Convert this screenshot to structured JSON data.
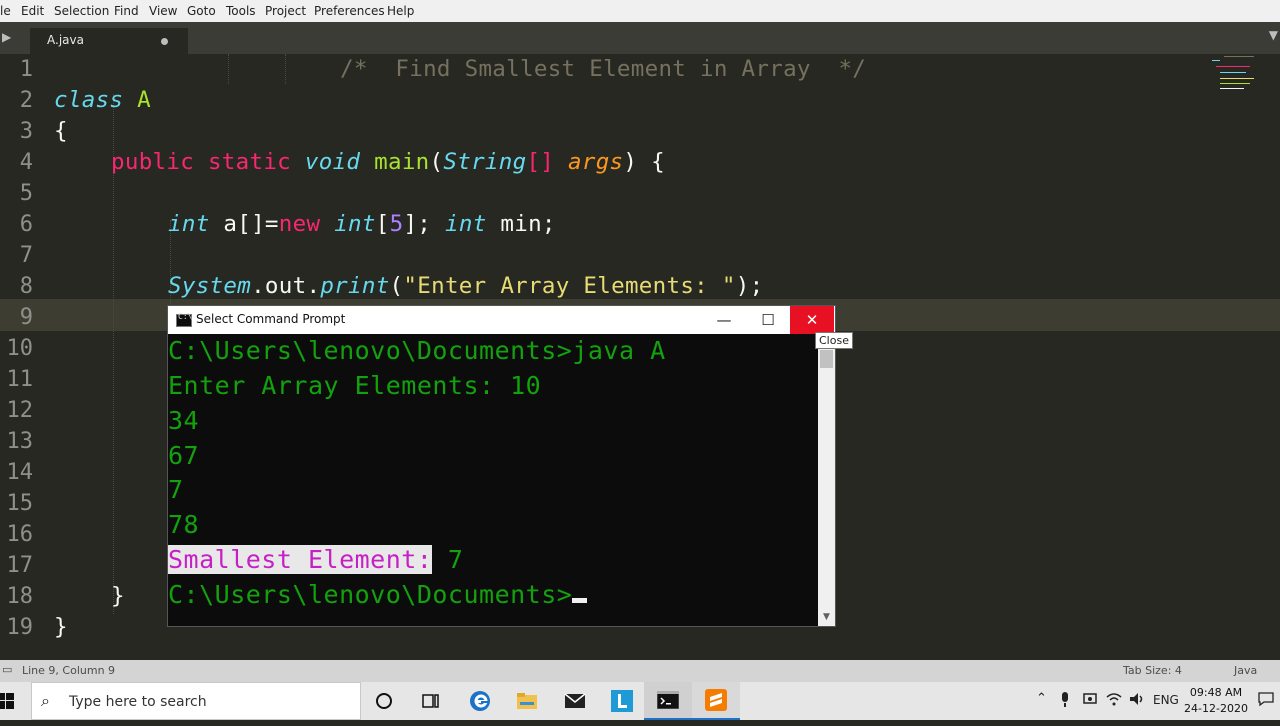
{
  "menu": {
    "items": [
      "le",
      "Edit",
      "Selection",
      "Find",
      "View",
      "Goto",
      "Tools",
      "Project",
      "Preferences",
      "Help"
    ]
  },
  "tab": {
    "label": "A.java"
  },
  "editor": {
    "line_numbers": [
      "1",
      "2",
      "3",
      "4",
      "5",
      "6",
      "7",
      "8",
      "9",
      "10",
      "11",
      "12",
      "13",
      "14",
      "15",
      "16",
      "17",
      "18",
      "19"
    ],
    "l1": "/*  Find Smallest Element in Array  */",
    "l2_kw": "class",
    "l2_name": "A",
    "l3": "{",
    "l4_public": "public",
    "l4_static": "static",
    "l4_void": "void",
    "l4_main": "main",
    "l4_paren": "(",
    "l4_string": "String",
    "l4_brackets": "[]",
    "l4_args": "args",
    "l4_end": ") {",
    "l6_int": "int",
    "l6_a": " a[]=",
    "l6_new": "new",
    "l6_int2": "int",
    "l6_lb": "[",
    "l6_five": "5",
    "l6_rb": "]; ",
    "l6_int3": "int",
    "l6_min": " min;",
    "l8_system": "System",
    "l8_out": ".out.",
    "l8_print": "print",
    "l8_open": "(",
    "l8_str": "\"Enter Array Elements: \"",
    "l8_close": ");",
    "l18": "}",
    "l19": "}"
  },
  "cmd": {
    "title": "Select Command Prompt",
    "minimize": "—",
    "maximize": "☐",
    "close": "✕",
    "tooltip": "Close",
    "lines": [
      "C:\\Users\\lenovo\\Documents>java A",
      "Enter Array Elements: 10",
      "34",
      "67",
      "7",
      "78"
    ],
    "selected": "Smallest Element:",
    "result": " 7",
    "prompt": "C:\\Users\\lenovo\\Documents>"
  },
  "status": {
    "position": "Line 9, Column 9",
    "tab_size": "Tab Size: 4",
    "syntax": "Java"
  },
  "taskbar": {
    "search_placeholder": "Type here to search",
    "language": "ENG",
    "time": "09:48 AM",
    "date": "24-12-2020"
  },
  "colors": {
    "editor_bg": "#272822",
    "keyword": "#f92672",
    "type": "#66d9ef",
    "function": "#a6e22e",
    "string": "#e6db74",
    "comment": "#75715e",
    "console_text": "#13a10e",
    "close_red": "#e81123"
  },
  "icons": [
    "windows-start-icon",
    "search-icon",
    "cortana-icon",
    "task-view-icon",
    "edge-icon",
    "file-explorer-icon",
    "mail-icon",
    "l-app-icon",
    "cmd-app-icon",
    "sublime-app-icon",
    "chevron-up-icon",
    "mic-icon",
    "network-icon",
    "wifi-icon",
    "volume-icon",
    "notification-icon"
  ]
}
